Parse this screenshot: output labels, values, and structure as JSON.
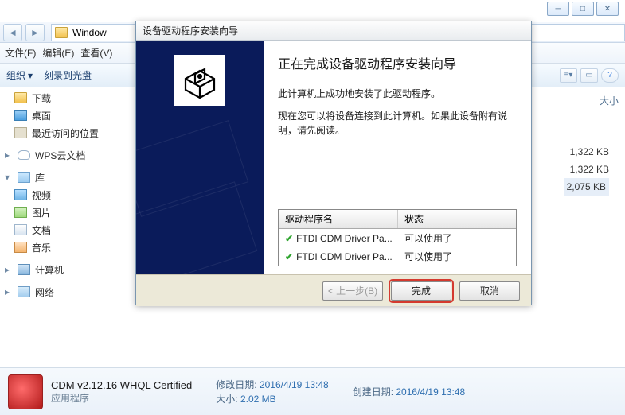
{
  "window": {
    "address_label": "Window"
  },
  "menubar": {
    "file": "文件(F)",
    "edit": "编辑(E)",
    "view": "查看(V)"
  },
  "toolbar": {
    "organize": "组织",
    "burn": "刻录到光盘"
  },
  "sidebar": {
    "downloads": "下载",
    "desktop": "桌面",
    "recent": "最近访问的位置",
    "wps": "WPS云文档",
    "library": "库",
    "video": "视频",
    "pictures": "图片",
    "documents": "文档",
    "music": "音乐",
    "computer": "计算机",
    "network": "网络"
  },
  "columns": {
    "size": "大小"
  },
  "filesizes": {
    "a": "1,322 KB",
    "b": "1,322 KB",
    "c": "2,075 KB"
  },
  "details": {
    "name": "CDM v2.12.16 WHQL Certified",
    "type": "应用程序",
    "mod_label": "修改日期:",
    "mod_value": "2016/4/19 13:48",
    "size_label": "大小:",
    "size_value": "2.02 MB",
    "created_label": "创建日期:",
    "created_value": "2016/4/19 13:48"
  },
  "wizard": {
    "title": "设备驱动程序安装向导",
    "heading": "正在完成设备驱动程序安装向导",
    "line1": "此计算机上成功地安装了此驱动程序。",
    "line2": "现在您可以将设备连接到此计算机。如果此设备附有说明，请先阅读。",
    "col_name": "驱动程序名",
    "col_status": "状态",
    "rows": [
      {
        "name": "FTDI CDM Driver Pa...",
        "status": "可以使用了"
      },
      {
        "name": "FTDI CDM Driver Pa...",
        "status": "可以使用了"
      }
    ],
    "back": "< 上一步(B)",
    "finish": "完成",
    "cancel": "取消"
  }
}
